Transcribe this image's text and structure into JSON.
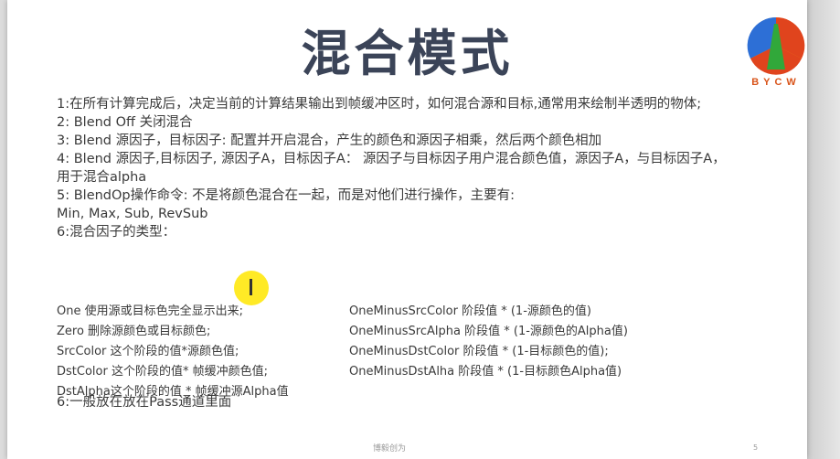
{
  "slide": {
    "title": "混合模式",
    "logo_text": "BYCW",
    "logo_colors": {
      "blue": "#2d6fd6",
      "red": "#e0441d",
      "green": "#31a83a",
      "orange": "#f0a020"
    },
    "lines": [
      "1:在所有计算完成后，决定当前的计算结果输出到帧缓冲区时，如何混合源和目标,通常用来绘制半透明的物体;",
      "2: Blend Off 关闭混合",
      "3: Blend 源因子，目标因子: 配置并开启混合，产生的颜色和源因子相乘，然后两个颜色相加",
      "4: Blend 源因子,目标因子, 源因子A，目标因子A： 源因子与目标因子用户混合颜色值，源因子A，与目标因子A，用于混合alpha",
      "5: BlendOp操作命令: 不是将颜色混合在一起，而是对他们进行操作，主要有:",
      "Min, Max, Sub, RevSub",
      "6:混合因子的类型："
    ],
    "factors_left": [
      "One 使用源或目标色完全显示出来;",
      "Zero 删除源颜色或目标颜色;",
      "SrcColor 这个阶段的值*源颜色值;",
      "DstColor 这个阶段的值* 帧缓冲颜色值;",
      "DstAlpha这个阶段的值 * 帧缓冲源Alpha值"
    ],
    "factors_right": [
      "OneMinusSrcColor 阶段值 * (1-源颜色的值)",
      "OneMinusSrcAlpha 阶段值 * (1-源颜色的Alpha值)",
      "OneMinusDstColor 阶段值 * (1-目标颜色的值);",
      "OneMinusDstAlha 阶段值 * (1-目标颜色Alpha值)",
      ""
    ],
    "last_line": "6:一般放在放在Pass通道里面",
    "footer": "博毅创为",
    "page_number": "5"
  }
}
